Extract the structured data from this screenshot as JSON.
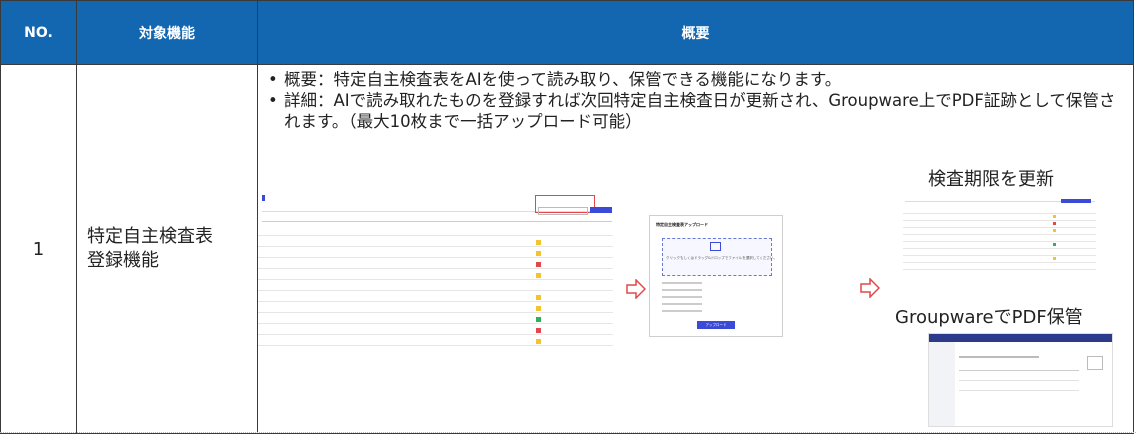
{
  "header": {
    "no": "NO.",
    "feature": "対象機能",
    "overview": "概要"
  },
  "row": {
    "no": "1",
    "feature_line1": "特定自主検査表",
    "feature_line2": "登録機能",
    "bullets": [
      "概要：特定自主検査表をAIを使って読み取り、保管できる機能になります。",
      "詳細：AIで読み取れたものを登録すれば次回特定自主検査日が更新され、Groupware上でPDF証跡として保管されます。（最大10枚まで一括アップロード可能）"
    ],
    "label_update": "検査期限を更新",
    "label_store": "GroupwareでPDF保管"
  },
  "upload_dialog": {
    "title": "特定自主検査表アップロード",
    "hint": "クリックもしくはドラッグ&ドロップでファイルを選択してください。",
    "button": "アップロード"
  },
  "colors": {
    "header_bg": "#1267b0",
    "arrow": "#e0484a",
    "accent": "#3b4bd8"
  }
}
